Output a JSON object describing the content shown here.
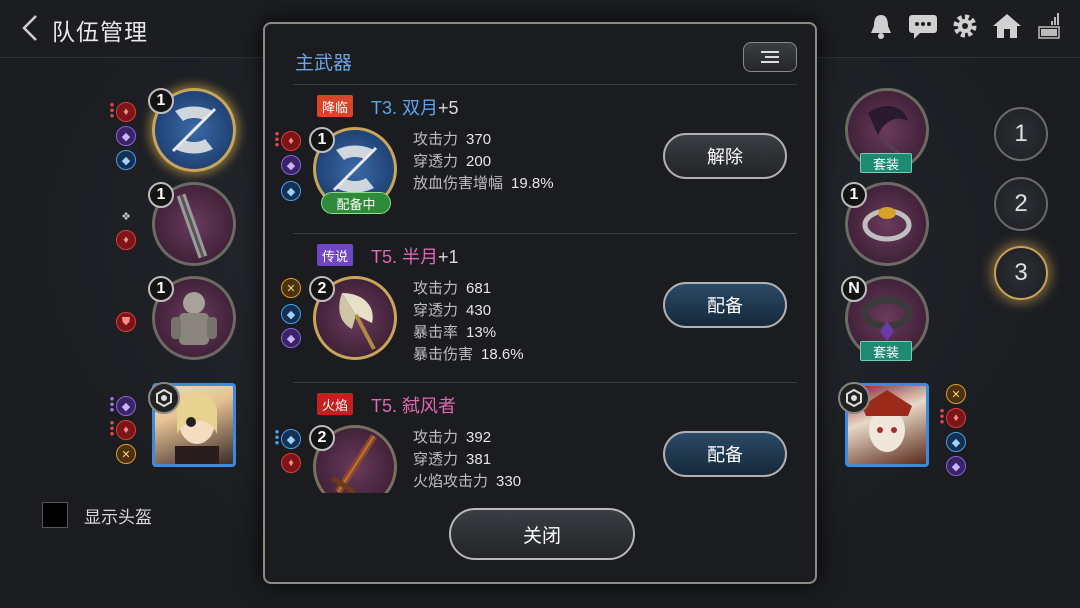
{
  "header": {
    "title": "队伍管理",
    "icons": [
      "back-icon",
      "bell-icon",
      "chat-icon",
      "gear-icon",
      "home-icon",
      "battery-signal-icon"
    ]
  },
  "left_column": {
    "slots": [
      {
        "level": "1",
        "type": "weapon",
        "gems": [
          "red",
          "purple",
          "blue"
        ]
      },
      {
        "level": "1",
        "type": "weapon-secondary",
        "gems": [
          "grey",
          "red"
        ]
      },
      {
        "level": "1",
        "type": "armor",
        "gems": [
          "red"
        ]
      }
    ],
    "helmet_toggle_label": "显示头盔"
  },
  "right_column": {
    "slots": [
      {
        "level": "",
        "set_label": "套装"
      },
      {
        "level": "1",
        "set_label": ""
      },
      {
        "level": "N",
        "set_label": "套装"
      }
    ],
    "team_buttons": [
      "1",
      "2",
      "3"
    ],
    "active_team": "3"
  },
  "modal": {
    "title": "主武器",
    "items": [
      {
        "tag": "降临",
        "name": "T3. 双月",
        "plus": "+5",
        "level": "1",
        "equipped_label": "配备中",
        "stats": [
          {
            "name": "攻击力",
            "value": "370"
          },
          {
            "name": "穿透力",
            "value": "200"
          },
          {
            "name": "放血伤害增幅",
            "value": "19.8%"
          }
        ],
        "action": "解除"
      },
      {
        "tag": "传说",
        "name": "T5. 半月",
        "plus": "+1",
        "level": "2",
        "stats": [
          {
            "name": "攻击力",
            "value": "681"
          },
          {
            "name": "穿透力",
            "value": "430"
          },
          {
            "name": "暴击率",
            "value": "13%"
          },
          {
            "name": "暴击伤害",
            "value": "18.6%"
          }
        ],
        "action": "配备"
      },
      {
        "tag": "火焰",
        "name": "T5. 弑风者",
        "plus": "",
        "level": "2",
        "stats": [
          {
            "name": "攻击力",
            "value": "392"
          },
          {
            "name": "穿透力",
            "value": "381"
          },
          {
            "name": "火焰攻击力",
            "value": "330"
          }
        ],
        "action": "配备"
      }
    ],
    "close_label": "关闭"
  }
}
